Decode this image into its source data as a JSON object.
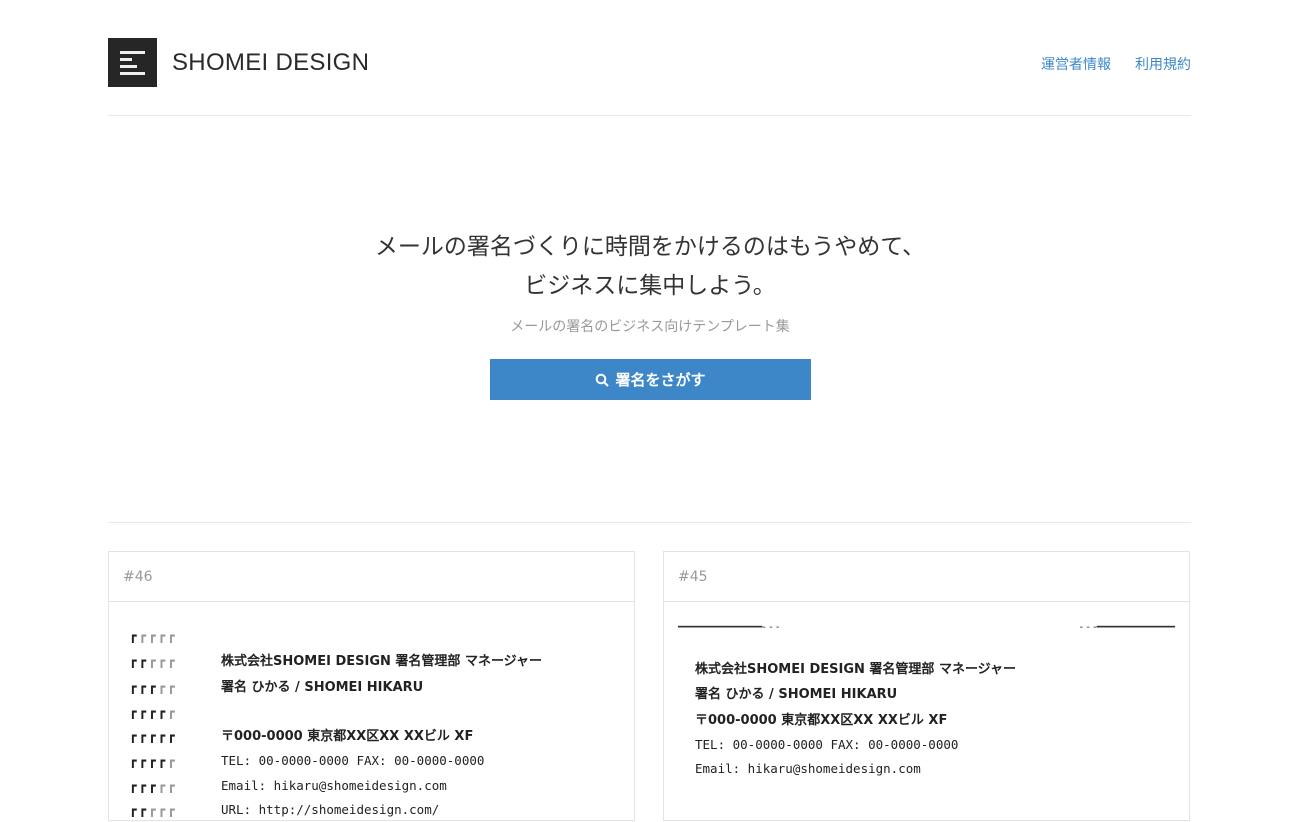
{
  "header": {
    "brand": "SHOMEI DESIGN",
    "nav": [
      "運営者情報",
      "利用規約"
    ]
  },
  "hero": {
    "line1": "メールの署名づくりに時間をかけるのはもうやめて、",
    "line2": "ビジネスに集中しよう。",
    "subtitle": "メールの署名のビジネス向けテンプレート集",
    "search_button": "署名をさがす"
  },
  "cards": [
    {
      "id": "#46",
      "marks": [
        "┏",
        "┏┏",
        "┏┏┏",
        "┏┏┏┏",
        "┏┏┏┏┏",
        "┏┏┏┏",
        "┏┏┏",
        "┏┏"
      ],
      "lines": [
        "",
        "株式会社SHOMEI DESIGN 署名管理部 マネージャー",
        "署名 ひかる / SHOMEI HIKARU",
        "",
        "〒000-0000 東京都XX区XX XXビル XF",
        "TEL: 00-0000-0000 FAX: 00-0000-0000",
        "Email: hikaru@shomeidesign.com",
        "URL: http://shomeidesign.com/"
      ]
    },
    {
      "id": "#45",
      "rule_left": "━━━━━━━━━━━━━━- - -",
      "rule_right": "- - -━━━━━━━━━━━━━",
      "lines": [
        "株式会社SHOMEI DESIGN 署名管理部 マネージャー",
        "署名 ひかる / SHOMEI HIKARU",
        "",
        "〒000-0000 東京都XX区XX XXビル XF",
        "TEL: 00-0000-0000 FAX: 00-0000-0000",
        "Email: hikaru@shomeidesign.com"
      ]
    }
  ]
}
